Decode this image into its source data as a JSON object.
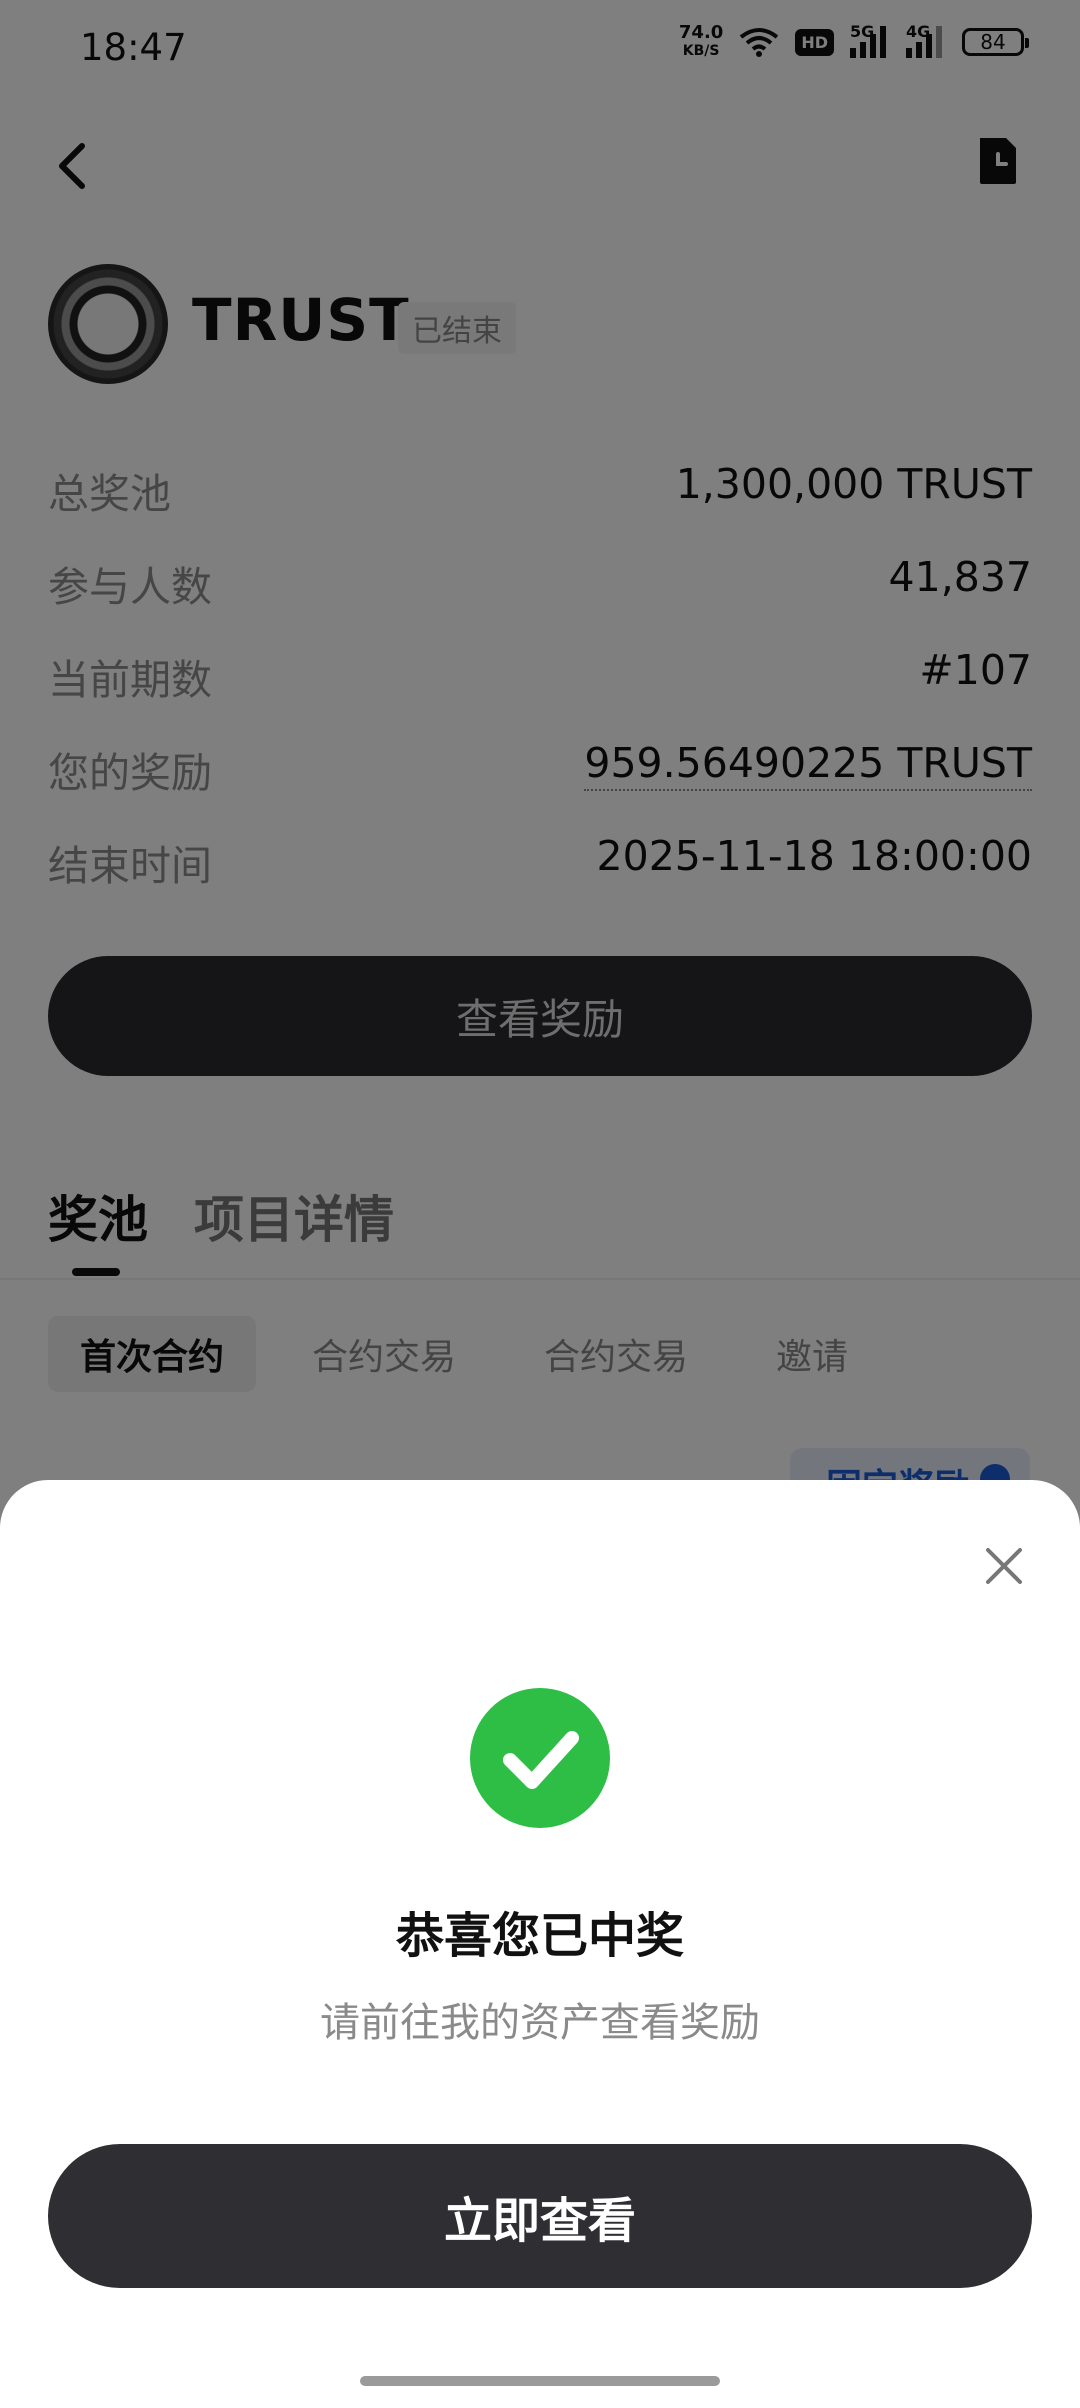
{
  "status_bar": {
    "time": "18:47",
    "speed": "74.0",
    "speed_unit": "KB/S",
    "hd": "HD",
    "sim1": "5G",
    "sim2": "4G",
    "battery": "84"
  },
  "token": {
    "name": "TRUST",
    "status": "已结束"
  },
  "info": [
    {
      "label": "总奖池",
      "value": "1,300,000 TRUST"
    },
    {
      "label": "参与人数",
      "value": "41,837"
    },
    {
      "label": "当前期数",
      "value": "#107"
    },
    {
      "label": "您的奖励",
      "value": "959.56490225 TRUST"
    },
    {
      "label": "结束时间",
      "value": "2025-11-18 18:00:00"
    }
  ],
  "view_reward_button": "查看奖励",
  "tabs": [
    {
      "label": "奖池"
    },
    {
      "label": "项目详情"
    }
  ],
  "chips": [
    {
      "label": "首次合约"
    },
    {
      "label": "合约交易"
    },
    {
      "label": "合约交易"
    },
    {
      "label": "邀请"
    }
  ],
  "fixed_reward_tag": "固定奖励",
  "sheet": {
    "title": "恭喜您已中奖",
    "subtitle": "请前往我的资产查看奖励",
    "button": "立即查看"
  },
  "colors": {
    "success": "#2ebd45",
    "button_dark": "#2e2e33",
    "accent_blue": "#1a5dd6"
  }
}
